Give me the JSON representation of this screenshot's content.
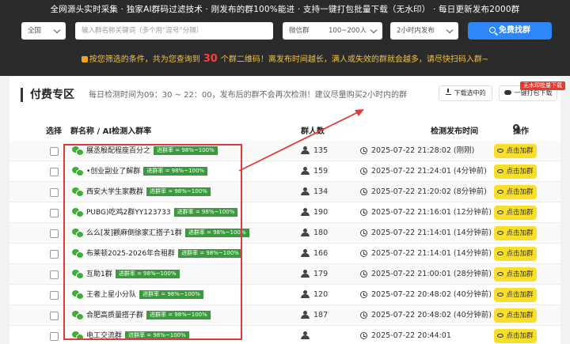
{
  "header": {
    "slogan": "全网源头实时采集 · 独家AI群码过滤技术 · 刚发布的群100%能进 · 支持一键打包批量下载（无水印） · 每日更新发布2000群",
    "filters": {
      "region": "全国",
      "keyword_placeholder": "输入群名称关键词（多个用“逗号”分隔）",
      "type": "微信群",
      "size": "100~200人",
      "time": "2小时内发布",
      "search_label": "免费找群"
    },
    "notice_prefix": "按您筛选的条件，共为您查询到",
    "notice_count": "30",
    "notice_suffix": "个群二维码！离发布时间越长，满人或失效的群就会越多，请尽快扫码入群~"
  },
  "section": {
    "title": "付费专区",
    "desc": "每日检测时间为09：30 ~ 22：00，发布后的群不会再次检测！建议尽量购买2小时内的群",
    "download_selected": "下载选中的",
    "download_all": "一键打包下载",
    "badge": "无水印批量下载"
  },
  "table": {
    "headers": {
      "select": "选择",
      "name": "群名称 / AI检测入群率",
      "members": "群人数",
      "time": "检测发布时间",
      "action": "操作"
    },
    "rate_label": "进群率 = 98%~100%",
    "join_label": "点击加群",
    "rows": [
      {
        "name": "展丞殷配程座百分之",
        "members": "135",
        "time": "2025-07-22 21:28:02 (刚刚)"
      },
      {
        "name": "•创业副业了解群",
        "members": "159",
        "time": "2025-07-22 21:24:01 (4分钟前)"
      },
      {
        "name": "西安大学生家教群",
        "members": "134",
        "time": "2025-07-22 21:20:02 (8分钟前)"
      },
      {
        "name": "PUBG)吃鸡2群YY123733",
        "members": "190",
        "time": "2025-07-22 21:16:01 (12分钟前)"
      },
      {
        "name": "么么[发]颧麻倒徐家汇搭子1群",
        "members": "180",
        "time": "2025-07-22 21:14:01 (14分钟前)"
      },
      {
        "name": "布莱顿2025-2026年合租群",
        "members": "166",
        "time": "2025-07-22 21:14:01 (14分钟前)"
      },
      {
        "name": "互助1群",
        "members": "179",
        "time": "2025-07-22 21:00:01 (28分钟前)"
      },
      {
        "name": "王者上星小分队",
        "members": "120",
        "time": "2025-07-22 20:48:02 (40分钟前)"
      },
      {
        "name": "合肥高质量搭子群",
        "members": "187",
        "time": "2025-07-22 20:48:02 (40分钟前)"
      },
      {
        "name": "电工交流群",
        "members": "",
        "time": "2025-07-22 20:44:01"
      }
    ]
  }
}
